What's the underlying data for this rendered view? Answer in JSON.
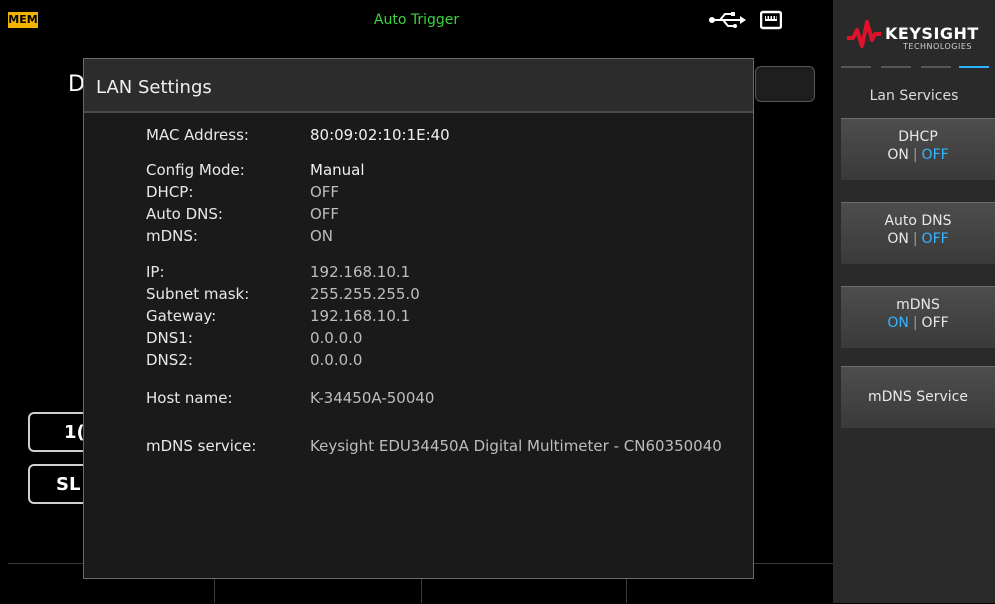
{
  "status_bar": {
    "mem_badge": "MEM",
    "trigger_status": "Auto Trigger",
    "usb_icon": "usb-icon",
    "lan_icon": "lan-icon"
  },
  "background": {
    "title_letter": "D",
    "button1_label": "1(",
    "button2_label": "SL"
  },
  "dialog": {
    "title": "LAN Settings",
    "rows": {
      "mac_address": {
        "label": "MAC Address:",
        "value": "80:09:02:10:1E:40"
      },
      "config_mode": {
        "label": "Config Mode:",
        "value": "Manual"
      },
      "dhcp": {
        "label": "DHCP:",
        "value": "OFF"
      },
      "auto_dns": {
        "label": "Auto DNS:",
        "value": "OFF"
      },
      "mdns": {
        "label": "mDNS:",
        "value": "ON"
      },
      "ip": {
        "label": "IP:",
        "value": "192.168.10.1"
      },
      "subnet_mask": {
        "label": "Subnet mask:",
        "value": "255.255.255.0"
      },
      "gateway": {
        "label": "Gateway:",
        "value": "192.168.10.1"
      },
      "dns1": {
        "label": "DNS1:",
        "value": "0.0.0.0"
      },
      "dns2": {
        "label": "DNS2:",
        "value": "0.0.0.0"
      },
      "host_name": {
        "label": "Host name:",
        "value": "K-34450A-50040"
      },
      "mdns_service": {
        "label": "mDNS service:",
        "value": "Keysight EDU34450A Digital Multimeter  - CN60350040"
      }
    }
  },
  "softkeys": {
    "brand_name": "KEYSIGHT",
    "brand_sub": "TECHNOLOGIES",
    "menu_title": "Lan Services",
    "dhcp": {
      "label": "DHCP",
      "on": "ON",
      "off": "OFF",
      "selected": "OFF"
    },
    "auto_dns": {
      "label": "Auto DNS",
      "on": "ON",
      "off": "OFF",
      "selected": "OFF"
    },
    "mdns": {
      "label": "mDNS",
      "on": "ON",
      "off": "OFF",
      "selected": "ON"
    },
    "mdns_service": {
      "label": "mDNS Service"
    }
  },
  "colors": {
    "accent": "#35b6ff",
    "status_green": "#3fd13f",
    "mem_badge": "#f2b400",
    "brand_red": "#e0122b"
  }
}
